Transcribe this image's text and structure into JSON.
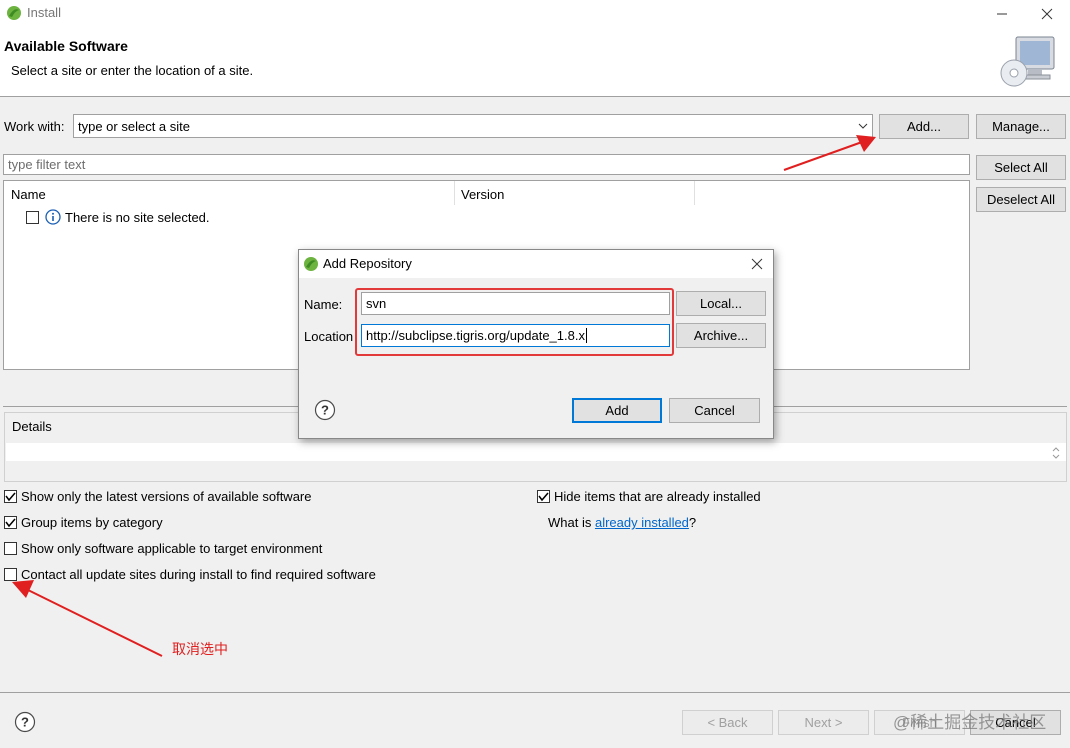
{
  "window": {
    "title": "Install"
  },
  "header": {
    "title": "Available Software",
    "subtitle": "Select a site or enter the location of a site."
  },
  "work_with": {
    "label": "Work with:",
    "placeholder": "type or select a site",
    "add_button": "Add...",
    "manage_button": "Manage..."
  },
  "filter": {
    "placeholder": "type filter text"
  },
  "side_buttons": {
    "select_all": "Select All",
    "deselect_all": "Deselect All"
  },
  "table": {
    "columns": [
      "Name",
      "Version"
    ],
    "rows": [
      {
        "label": "There is no site selected.",
        "checked": false
      }
    ]
  },
  "details": {
    "label": "Details"
  },
  "options": {
    "latest_versions": {
      "label": "Show only the latest versions of available software",
      "checked": true
    },
    "group_by_category": {
      "label": "Group items by category",
      "checked": true
    },
    "target_env": {
      "label": "Show only software applicable to target environment",
      "checked": false
    },
    "contact_sites": {
      "label": "Contact all update sites during install to find required software",
      "checked": false
    },
    "hide_installed": {
      "label": "Hide items that are already installed",
      "checked": true
    },
    "what_is_prefix": "What is ",
    "what_is_link": "already installed",
    "what_is_suffix": "?"
  },
  "footer": {
    "back": "< Back",
    "next": "Next >",
    "finish": "Finish",
    "cancel": "Cancel"
  },
  "annotation": {
    "text": "取消选中",
    "color": "#e02020"
  },
  "watermark": "@稀土掘金技术社区",
  "dialog": {
    "title": "Add Repository",
    "name_label": "Name:",
    "name_value": "svn",
    "location_label": "Location",
    "location_value": "http://subclipse.tigris.org/update_1.8.x",
    "local_button": "Local...",
    "archive_button": "Archive...",
    "add_button": "Add",
    "cancel_button": "Cancel"
  },
  "colors": {
    "accent": "#0078d7",
    "highlight": "#e23a3a",
    "link": "#0066cc"
  }
}
